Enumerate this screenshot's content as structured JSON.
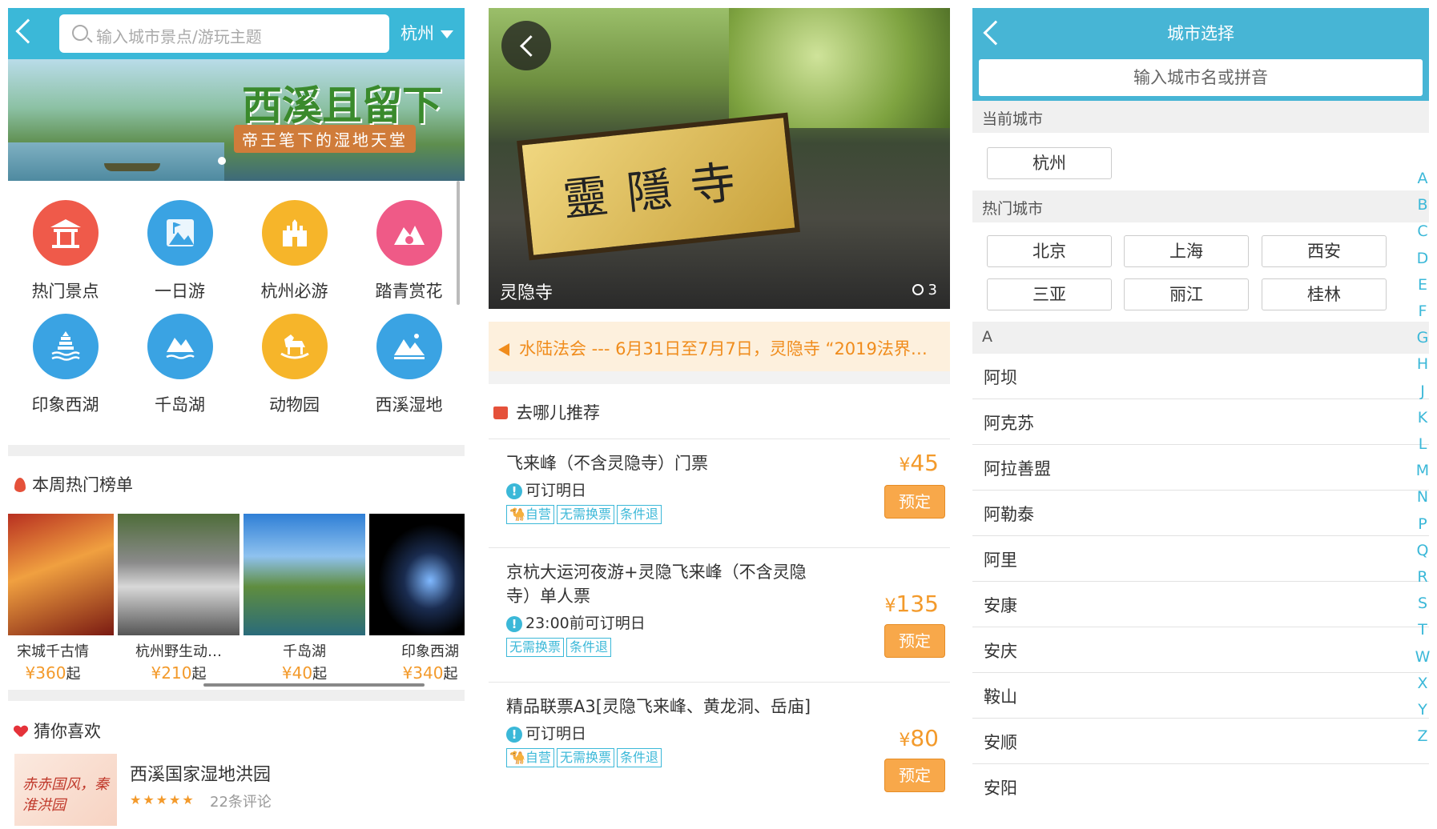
{
  "home": {
    "search_placeholder": "输入城市景点/游玩主题",
    "city": "杭州",
    "banner": {
      "title": "西溪且留下",
      "subtitle": "帝王笔下的湿地天堂"
    },
    "categories": [
      {
        "label": "热门景点",
        "icon": "pavilion-icon",
        "color": "#ef5a4a"
      },
      {
        "label": "一日游",
        "icon": "map-flag-icon",
        "color": "#3aa3e3"
      },
      {
        "label": "杭州必游",
        "icon": "castle-icon",
        "color": "#f6b52a"
      },
      {
        "label": "踏青赏花",
        "icon": "flower-mountain-icon",
        "color": "#ef5a87"
      },
      {
        "label": "印象西湖",
        "icon": "pagoda-icon",
        "color": "#3aa3e3"
      },
      {
        "label": "千岛湖",
        "icon": "island-icon",
        "color": "#3aa3e3"
      },
      {
        "label": "动物园",
        "icon": "rocking-horse-icon",
        "color": "#f6b52a"
      },
      {
        "label": "西溪湿地",
        "icon": "mountain-lake-icon",
        "color": "#3aa3e3"
      }
    ],
    "hot_title": "本周热门榜单",
    "hot": [
      {
        "name": "宋城千古情",
        "price": "¥360",
        "suffix": "起"
      },
      {
        "name": "杭州野生动…",
        "price": "¥210",
        "suffix": "起"
      },
      {
        "name": "千岛湖",
        "price": "¥40",
        "suffix": "起"
      },
      {
        "name": "印象西湖",
        "price": "¥340",
        "suffix": "起"
      }
    ],
    "like_title": "猜你喜欢",
    "like": {
      "name": "西溪国家湿地洪园",
      "thumb_text": "赤赤国风，秦淮洪园",
      "stars": "★★★★★",
      "reviews": "22条评论"
    }
  },
  "detail": {
    "name": "灵隐寺",
    "plaque": "靈隱寺",
    "photo_count": "3",
    "notice": "水陆法会 --- 6月31日至7月7日，灵隐寺 “2019法界…",
    "rec_title": "去哪儿推荐",
    "book_label": "预定",
    "tickets": [
      {
        "title": "飞来峰（不含灵隐寺）门票",
        "info": "可订明日",
        "tags": [
          "自营",
          "无需换票",
          "条件退"
        ],
        "price": "45"
      },
      {
        "title": "京杭大运河夜游+灵隐飞来峰（不含灵隐寺）单人票",
        "info": "23:00前可订明日",
        "tags": [
          "无需换票",
          "条件退"
        ],
        "price": "135"
      },
      {
        "title": "精品联票A3[灵隐飞来峰、黄龙洞、岳庙]",
        "info": "可订明日",
        "tags": [
          "自营",
          "无需换票",
          "条件退"
        ],
        "price": "80"
      }
    ]
  },
  "city": {
    "title": "城市选择",
    "input_placeholder": "输入城市名或拼音",
    "current_label": "当前城市",
    "current": "杭州",
    "hot_label": "热门城市",
    "hot": [
      "北京",
      "上海",
      "西安",
      "三亚",
      "丽江",
      "桂林"
    ],
    "section_a": "A",
    "cities": [
      "阿坝",
      "阿克苏",
      "阿拉善盟",
      "阿勒泰",
      "阿里",
      "安康",
      "安庆",
      "鞍山",
      "安顺",
      "安阳"
    ],
    "index": [
      "A",
      "B",
      "C",
      "D",
      "E",
      "F",
      "G",
      "H",
      "J",
      "K",
      "L",
      "M",
      "N",
      "P",
      "Q",
      "R",
      "S",
      "T",
      "W",
      "X",
      "Y",
      "Z"
    ]
  }
}
